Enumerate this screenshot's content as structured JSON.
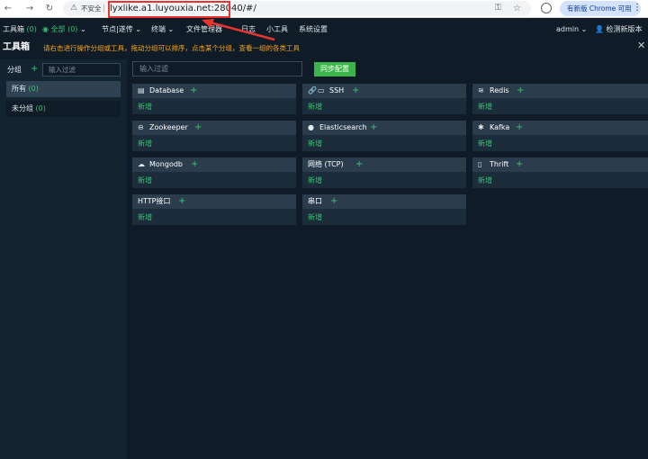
{
  "browser": {
    "insecure_label": "不安全",
    "url": "lyxlike.a1.luyouxia.net:28040/#/",
    "update_label": "有新版 Chrome 可用"
  },
  "topbar": {
    "toolbox": "工具箱",
    "toolbox_count": "(0)",
    "all": "全部",
    "all_count": "(0)",
    "nodes": "节点|遂传",
    "terminal": "终端",
    "file_manager": "文件管理器",
    "logs": "日志",
    "tools": "小工具",
    "settings": "系统设置",
    "user": "admin",
    "check_update": "检测新版本"
  },
  "page": {
    "title": "工具箱",
    "hint": "请右击进行操作分组或工具，拖动分组可以排序，点击某个分组，查看一组的各类工具"
  },
  "groups": {
    "label": "分组",
    "filter_placeholder": "输入过滤",
    "items": [
      {
        "label": "所有",
        "count": "(0)"
      },
      {
        "label": "未分组",
        "count": "(0)"
      }
    ]
  },
  "main": {
    "filter_placeholder": "输入过滤",
    "sync_label": "同步配置",
    "new_label": "新增",
    "cards": [
      {
        "name": "Database",
        "icon": "database-icon"
      },
      {
        "name": "SSH",
        "icon": "link-icon"
      },
      {
        "name": "Redis",
        "icon": "layers-icon"
      },
      {
        "name": "Zookeeper",
        "icon": "minus-circle-icon"
      },
      {
        "name": "Elasticsearch",
        "icon": "elastic-icon"
      },
      {
        "name": "Kafka",
        "icon": "kafka-icon"
      },
      {
        "name": "Mongodb",
        "icon": "cloud-icon"
      },
      {
        "name": "网络 (TCP)",
        "icon": ""
      },
      {
        "name": "Thrift",
        "icon": "file-icon"
      },
      {
        "name": "HTTP接口",
        "icon": ""
      },
      {
        "name": "串口",
        "icon": ""
      }
    ]
  },
  "colors": {
    "accent_green": "#38c172",
    "hint_orange": "#f5a623",
    "annotation_red": "#e8342f"
  }
}
